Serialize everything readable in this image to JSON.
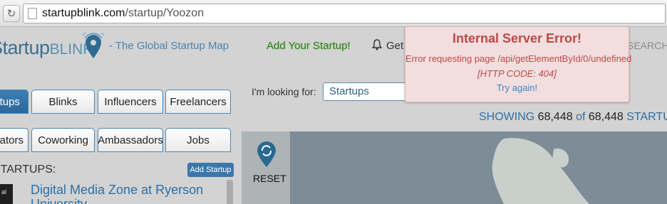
{
  "browser": {
    "reload_icon": "reload-icon",
    "url_host": "startupblink.com",
    "url_path": "/startup/Yoozon"
  },
  "header": {
    "logo_main": "Startup",
    "logo_blink": "BLINK",
    "tagline": "- The Global Startup Map",
    "add_startup_link": "Add Your Startup!",
    "get_label": "Get",
    "search_label": "SEARCH"
  },
  "tabs_row1": [
    "Startups",
    "Blinks",
    "Influencers",
    "Freelancers"
  ],
  "tabs_row2": [
    "Accelerators",
    "Coworking",
    "Ambassadors",
    "Jobs"
  ],
  "filter": {
    "looking_label": "I'm looking for:",
    "selected": "Startups"
  },
  "showing": {
    "prefix": "SHOWING",
    "count": "68,448",
    "of": "of",
    "total": "68,448",
    "suffix": "STARTUPS"
  },
  "list": {
    "heading": "STARTUPS:",
    "add_button": "Add Startup",
    "items": [
      {
        "thumb": "al",
        "title": "Digital Media Zone at Ryerson University"
      }
    ]
  },
  "map": {
    "reset_label": "RESET"
  },
  "error": {
    "title": "Internal Server Error!",
    "message": "Error requesting page /api/getElementById/0/undefined",
    "code": "[HTTP CODE: 404]",
    "retry": "Try again!"
  },
  "colors": {
    "brand_blue": "#2e6fa3",
    "error_bg": "#f2dede",
    "error_text": "#b94a48",
    "add_green": "#2f7a1e"
  }
}
